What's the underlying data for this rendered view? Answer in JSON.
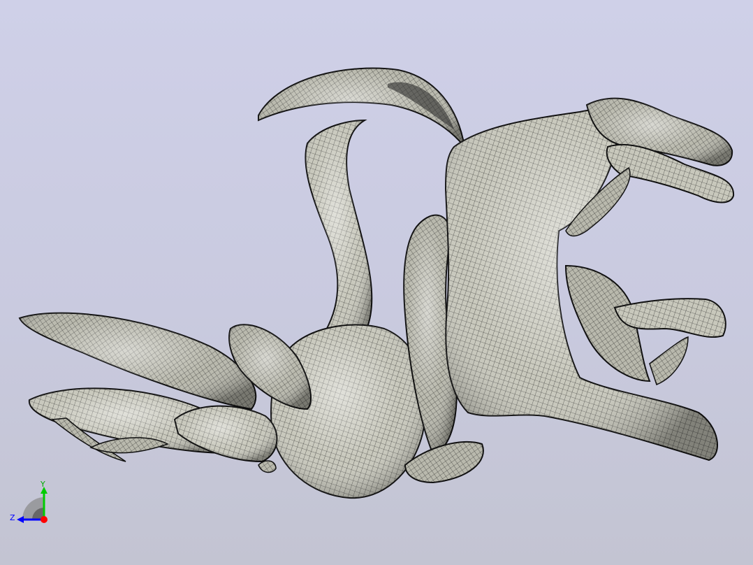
{
  "viewport": {
    "background_top": "#cfd0e8",
    "background_bottom": "#c3c4d2",
    "model_fill": "#c8c8bc",
    "mesh_color": "#1a1a1a"
  },
  "triad": {
    "y_label": "Y",
    "z_label": "Z",
    "x_color": "#ff0000",
    "y_color": "#00cc00",
    "z_color": "#0000ff"
  }
}
